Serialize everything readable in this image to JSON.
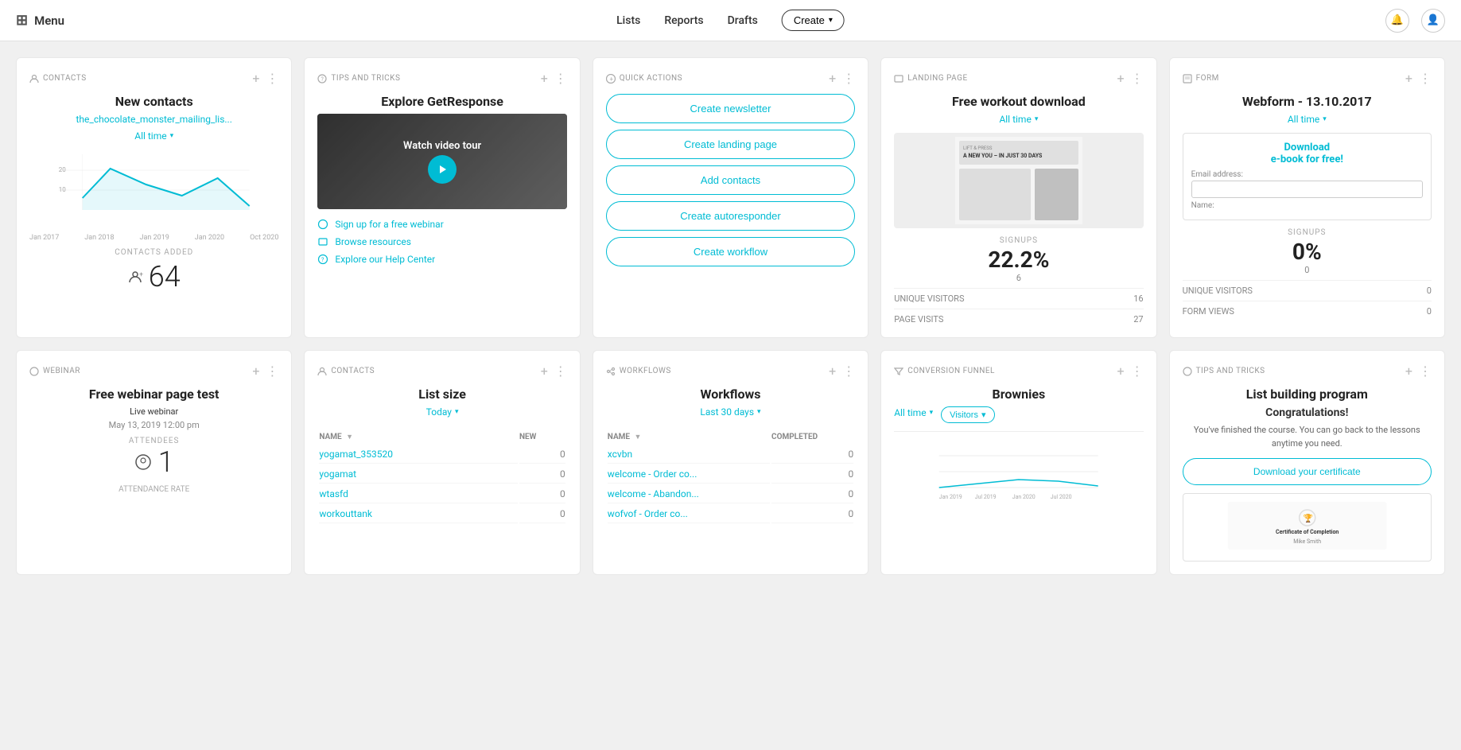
{
  "header": {
    "menu_label": "Menu",
    "nav": {
      "lists": "Lists",
      "reports": "Reports",
      "drafts": "Drafts",
      "create": "Create"
    }
  },
  "cards": {
    "contacts": {
      "label": "CONTACTS",
      "title": "New contacts",
      "link": "the_chocolate_monster_mailing_lis...",
      "filter": "All time",
      "y_labels": [
        "20",
        "10"
      ],
      "x_labels": [
        "Jan 2017",
        "Jan 2018",
        "Jan 2019",
        "Jan 2020",
        "Oct 2020"
      ],
      "contacts_added_label": "CONTACTS ADDED",
      "contacts_count": "64"
    },
    "tips": {
      "label": "TIPS AND TRICKS",
      "title": "Explore GetResponse",
      "video_label": "Watch video tour",
      "links": [
        "Sign up for a free webinar",
        "Browse resources",
        "Explore our Help Center"
      ]
    },
    "quick_actions": {
      "label": "QUICK ACTIONS",
      "buttons": [
        "Create newsletter",
        "Create landing page",
        "Add contacts",
        "Create autoresponder",
        "Create workflow"
      ]
    },
    "landing_page": {
      "label": "LANDING PAGE",
      "title": "Free workout download",
      "filter": "All time",
      "signups_label": "SIGNUPS",
      "signups_value": "22.2%",
      "signups_count": "6",
      "unique_visitors_label": "UNIQUE VISITORS",
      "unique_visitors_value": "16",
      "page_visits_label": "PAGE VISITS",
      "page_visits_value": "27"
    },
    "form": {
      "label": "FORM",
      "title": "Webform - 13.10.2017",
      "filter": "All time",
      "preview_title": "Download\ne-book for free!",
      "email_label": "Email address:",
      "name_label": "Name:",
      "signups_label": "SIGNUPS",
      "signups_value": "0%",
      "signups_count": "0",
      "unique_visitors_label": "UNIQUE VISITORS",
      "unique_visitors_value": "0",
      "form_views_label": "FORM VIEWS",
      "form_views_value": "0"
    },
    "webinar": {
      "label": "WEBINAR",
      "title": "Free webinar page test",
      "type": "Live webinar",
      "date": "May 13, 2019 12:00 pm",
      "attendees_label": "ATTENDEES",
      "attendees_count": "1",
      "attendance_rate_label": "ATTENDANCE RATE"
    },
    "list_size": {
      "label": "CONTACTS",
      "title": "List size",
      "filter": "Today",
      "col_name": "NAME",
      "col_new": "NEW",
      "rows": [
        {
          "name": "yogamat_353520",
          "new": "0"
        },
        {
          "name": "yogamat",
          "new": "0"
        },
        {
          "name": "wtasfd",
          "new": "0"
        },
        {
          "name": "workouttank",
          "new": "0"
        }
      ]
    },
    "workflows": {
      "label": "WORKFLOWS",
      "title": "Workflows",
      "filter": "Last 30 days",
      "col_name": "NAME",
      "col_completed": "COMPLETED",
      "rows": [
        {
          "name": "xcvbn",
          "completed": "0"
        },
        {
          "name": "welcome - Order co...",
          "completed": "0"
        },
        {
          "name": "welcome - Abandon...",
          "completed": "0"
        },
        {
          "name": "wofvof - Order co...",
          "completed": "0"
        }
      ]
    },
    "conversion_funnel": {
      "label": "CONVERSION FUNNEL",
      "title": "Brownies",
      "filter": "All time",
      "visitors_label": "Visitors",
      "x_labels": [
        "Jan 2019",
        "Jul 2019",
        "Jan 2020",
        "Jul 2020"
      ]
    },
    "tips_bottom": {
      "label": "TIPS AND TRICKS",
      "title": "List building program",
      "congrats": "Congratulations!",
      "text": "You've finished the course. You can go back to the lessons anytime you need.",
      "download_btn": "Download your certificate",
      "cert_title": "Certificate of Completion",
      "cert_name": "Mike Smith"
    }
  }
}
